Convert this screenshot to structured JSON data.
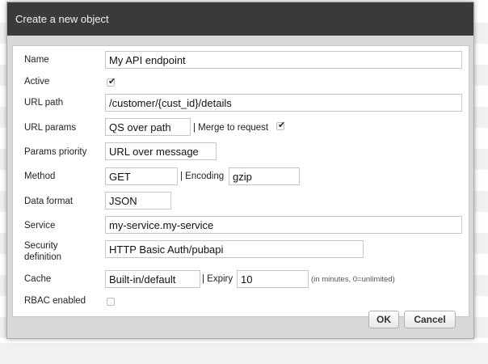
{
  "dialog": {
    "title": "Create a new object"
  },
  "form": {
    "name": {
      "label": "Name",
      "value": "My API endpoint"
    },
    "active": {
      "label": "Active",
      "checked": true
    },
    "url_path": {
      "label": "URL path",
      "value": "/customer/{cust_id}/details"
    },
    "url_params": {
      "label": "URL params",
      "value": "QS over path",
      "merge_label": "| Merge to request",
      "merge_checked": true
    },
    "params_priority": {
      "label": "Params priority",
      "value": "URL over message"
    },
    "method": {
      "label": "Method",
      "value": "GET",
      "encoding_label": "| Encoding",
      "encoding_value": "gzip"
    },
    "data_format": {
      "label": "Data format",
      "value": "JSON"
    },
    "service": {
      "label": "Service",
      "value": "my-service.my-service"
    },
    "security": {
      "label_line1": "Security",
      "label_line2": "definition",
      "value": "HTTP Basic Auth/pubapi"
    },
    "cache": {
      "label": "Cache",
      "value": "Built-in/default",
      "expiry_label": "| Expiry",
      "expiry_value": "10",
      "expiry_hint": "(in minutes, 0=unlimited)"
    },
    "rbac": {
      "label": "RBAC enabled",
      "checked": false
    }
  },
  "buttons": {
    "ok_label": "OK",
    "cancel_label": "Cancel"
  },
  "icons": {
    "checkmark": "check-icon"
  }
}
